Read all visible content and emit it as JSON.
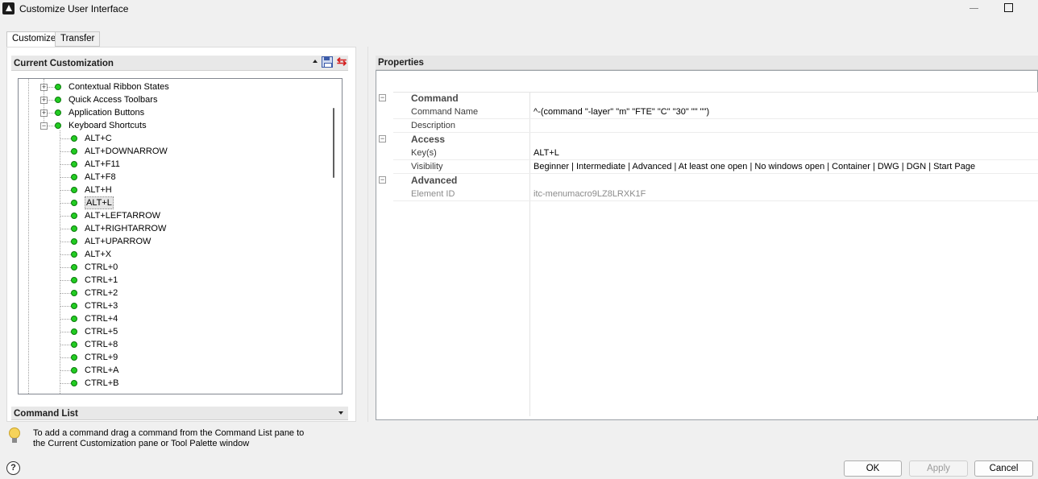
{
  "window": {
    "title": "Customize User Interface"
  },
  "tabs": [
    {
      "label": "Customize",
      "active": true
    },
    {
      "label": "Transfer",
      "active": false
    }
  ],
  "current_customization": {
    "title": "Current Customization",
    "tree": [
      {
        "label": "Contextual Ribbon States",
        "level": 1,
        "expander": "+"
      },
      {
        "label": "Quick Access Toolbars",
        "level": 1,
        "expander": "+"
      },
      {
        "label": "Application Buttons",
        "level": 1,
        "expander": "+"
      },
      {
        "label": "Keyboard Shortcuts",
        "level": 1,
        "expander": "−"
      },
      {
        "label": "ALT+C",
        "level": 2
      },
      {
        "label": "ALT+DOWNARROW",
        "level": 2
      },
      {
        "label": "ALT+F11",
        "level": 2
      },
      {
        "label": "ALT+F8",
        "level": 2
      },
      {
        "label": "ALT+H",
        "level": 2
      },
      {
        "label": "ALT+L",
        "level": 2,
        "selected": true
      },
      {
        "label": "ALT+LEFTARROW",
        "level": 2
      },
      {
        "label": "ALT+RIGHTARROW",
        "level": 2
      },
      {
        "label": "ALT+UPARROW",
        "level": 2
      },
      {
        "label": "ALT+X",
        "level": 2
      },
      {
        "label": "CTRL+0",
        "level": 2
      },
      {
        "label": "CTRL+1",
        "level": 2
      },
      {
        "label": "CTRL+2",
        "level": 2
      },
      {
        "label": "CTRL+3",
        "level": 2
      },
      {
        "label": "CTRL+4",
        "level": 2
      },
      {
        "label": "CTRL+5",
        "level": 2
      },
      {
        "label": "CTRL+8",
        "level": 2
      },
      {
        "label": "CTRL+9",
        "level": 2
      },
      {
        "label": "CTRL+A",
        "level": 2
      },
      {
        "label": "CTRL+B",
        "level": 2
      }
    ]
  },
  "command_list": {
    "title": "Command List",
    "hint_line1": "To add a command drag a command from the Command List pane to",
    "hint_line2": "the Current Customization pane or Tool Palette window"
  },
  "properties": {
    "title": "Properties",
    "categories": [
      {
        "label": "Command",
        "rows": [
          {
            "name": "Command Name",
            "value": "^-(command \"-layer\" \"m\" \"FTE\" \"C\" \"30\" \"\" \"\")"
          },
          {
            "name": "Description",
            "value": ""
          }
        ]
      },
      {
        "label": "Access",
        "rows": [
          {
            "name": "Key(s)",
            "value": "ALT+L"
          },
          {
            "name": "Visibility",
            "value": "Beginner | Intermediate | Advanced | At least one open | No windows open | Container | DWG | DGN | Start Page"
          }
        ]
      },
      {
        "label": "Advanced",
        "rows": [
          {
            "name": "Element ID",
            "value": "itc-menumacro9LZ8LRXK1F",
            "readonly": true
          }
        ]
      }
    ]
  },
  "buttons": {
    "ok": "OK",
    "apply": "Apply",
    "cancel": "Cancel"
  }
}
